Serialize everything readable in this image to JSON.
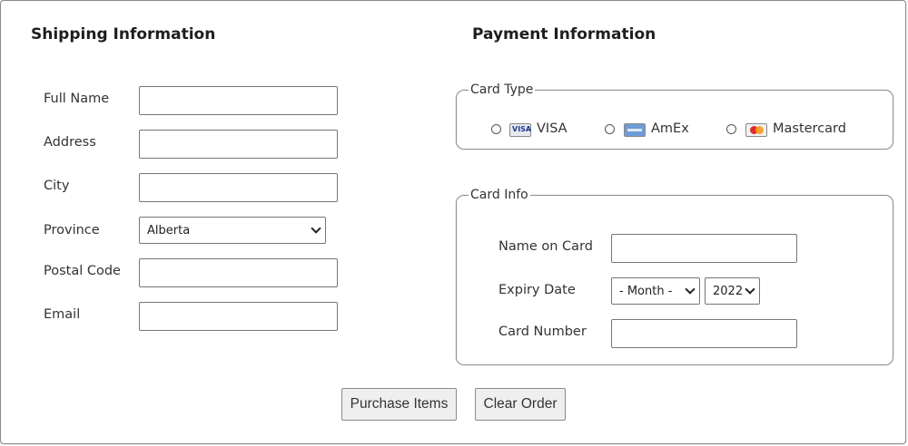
{
  "shipping": {
    "title": "Shipping Information",
    "fields": {
      "full_name": {
        "label": "Full Name",
        "value": ""
      },
      "address": {
        "label": "Address",
        "value": ""
      },
      "city": {
        "label": "City",
        "value": ""
      },
      "province": {
        "label": "Province",
        "selected": "Alberta"
      },
      "postal_code": {
        "label": "Postal Code",
        "value": ""
      },
      "email": {
        "label": "Email",
        "value": ""
      }
    }
  },
  "payment": {
    "title": "Payment Information",
    "card_type": {
      "legend": "Card Type",
      "options": [
        {
          "label": "VISA",
          "icon": "visa-card-icon"
        },
        {
          "label": "AmEx",
          "icon": "amex-card-icon"
        },
        {
          "label": "Mastercard",
          "icon": "mastercard-card-icon"
        }
      ]
    },
    "card_info": {
      "legend": "Card Info",
      "name_on_card": {
        "label": "Name on Card",
        "value": ""
      },
      "expiry": {
        "label": "Expiry Date",
        "month_selected": "- Month -",
        "year_selected": "2022"
      },
      "card_number": {
        "label": "Card Number",
        "value": ""
      }
    }
  },
  "actions": {
    "purchase_label": "Purchase Items",
    "clear_label": "Clear Order"
  }
}
